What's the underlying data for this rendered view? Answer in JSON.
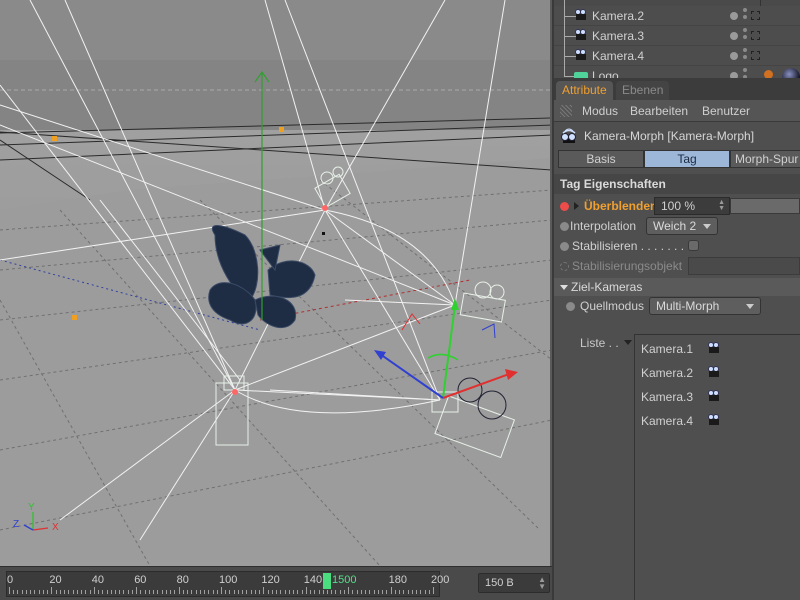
{
  "viewport": {
    "axis_labels": {
      "x": "X",
      "y": "Y",
      "z": "Z"
    },
    "colors": {
      "background": "#8e8e8e",
      "floor": "#9a9a9a",
      "wire": "#e8f0e8",
      "x_axis": "#e03030",
      "y_axis": "#30c030",
      "z_axis": "#3040d0",
      "point": "#f0a020",
      "object": "#1e2c44"
    }
  },
  "timeline": {
    "ticks": [
      "0",
      "20",
      "40",
      "60",
      "80",
      "100",
      "120",
      "140",
      "1500",
      "180",
      "200"
    ],
    "current_frame_label": "1500",
    "current_frame_value": 150,
    "range_start": 0,
    "range_end": 200,
    "frame_field": "150 B",
    "accent": "#4cdc80"
  },
  "object_manager": {
    "rows": [
      {
        "name": "Kamera.2",
        "icon": "camera-icon"
      },
      {
        "name": "Kamera.3",
        "icon": "camera-icon"
      },
      {
        "name": "Kamera.4",
        "icon": "camera-icon"
      },
      {
        "name": "Logo",
        "icon": "null-object-icon"
      }
    ]
  },
  "attribute_manager": {
    "tabs": [
      {
        "label": "Attribute",
        "active": true
      },
      {
        "label": "Ebenen",
        "active": false
      }
    ],
    "menu": [
      "Modus",
      "Bearbeiten",
      "Benutzer"
    ],
    "object_title": "Kamera-Morph [Kamera-Morph]",
    "subtabs": [
      {
        "label": "Basis",
        "active": false
      },
      {
        "label": "Tag",
        "active": true
      },
      {
        "label": "Morph-Spur",
        "active": false
      }
    ],
    "section_title": "Tag Eigenschaften",
    "properties": {
      "ueberblenden": {
        "label": "Überblenden",
        "value": "100 %",
        "fraction": 1.0
      },
      "interpolation": {
        "label": "Interpolation",
        "value": "Weich 2"
      },
      "stabilisieren": {
        "label": "Stabilisieren . . . . . . .",
        "checked": false
      },
      "stabilisierungsobjekt": {
        "label": "Stabilisierungsobjekt",
        "value": ""
      }
    },
    "group_title": "Ziel-Kameras",
    "quellmodus": {
      "label": "Quellmodus",
      "value": "Multi-Morph"
    },
    "liste": {
      "label": "Liste . .",
      "items": [
        "Kamera.1",
        "Kamera.2",
        "Kamera.3",
        "Kamera.4"
      ]
    },
    "accent": "#f0a030",
    "active_tab_color": "#9db7d9"
  }
}
